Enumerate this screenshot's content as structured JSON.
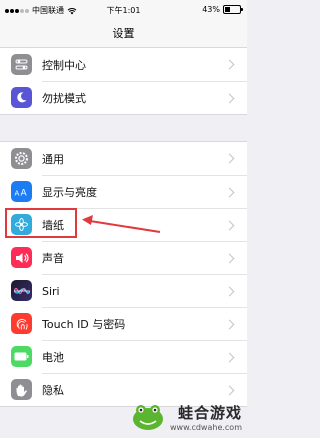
{
  "status_bar": {
    "carrier": "中国联通",
    "time": "下午1:01",
    "battery_percent": "43%",
    "battery_level": 0.43
  },
  "nav": {
    "title": "设置"
  },
  "groups": [
    {
      "rows": [
        {
          "label": "控制中心",
          "icon": "control-center-icon",
          "color": "#8e8e93"
        },
        {
          "label": "勿扰模式",
          "icon": "moon-icon",
          "color": "#5856d6"
        }
      ]
    },
    {
      "rows": [
        {
          "label": "通用",
          "icon": "gear-icon",
          "color": "#8e8e93"
        },
        {
          "label": "显示与亮度",
          "icon": "text-size-icon",
          "color": "#1c7cf4"
        },
        {
          "label": "墙纸",
          "icon": "wallpaper-icon",
          "color": "#33aadc"
        },
        {
          "label": "声音",
          "icon": "speaker-icon",
          "color": "#ff2d55"
        },
        {
          "label": "Siri",
          "icon": "siri-icon",
          "color": "#1a1a2e"
        },
        {
          "label": "Touch ID 与密码",
          "icon": "fingerprint-icon",
          "color": "#ff3b30"
        },
        {
          "label": "电池",
          "icon": "battery-icon",
          "color": "#4cd964"
        },
        {
          "label": "隐私",
          "icon": "hand-icon",
          "color": "#8e8e93"
        }
      ]
    }
  ],
  "annotation": {
    "highlight_color": "#e0393e",
    "target": "墙纸"
  },
  "watermark": {
    "title": "蛙合游戏",
    "url": "www.cdwahe.com"
  }
}
